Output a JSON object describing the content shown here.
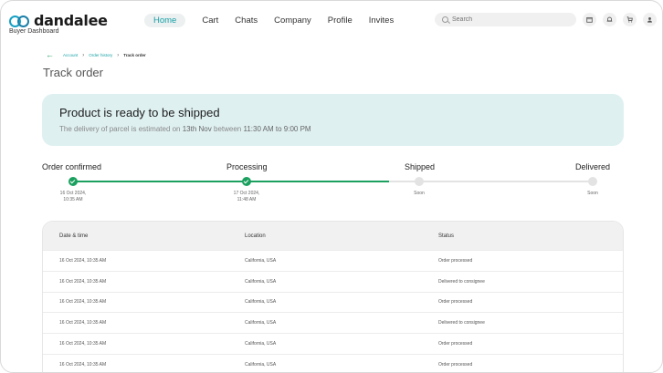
{
  "brand": {
    "name": "dandalee",
    "subtitle": "Buyer Dashboard"
  },
  "nav": [
    {
      "label": "Home",
      "active": true
    },
    {
      "label": "Cart"
    },
    {
      "label": "Chats"
    },
    {
      "label": "Company"
    },
    {
      "label": "Profile"
    },
    {
      "label": "Invites"
    }
  ],
  "search": {
    "placeholder": "Search"
  },
  "header_icons": [
    "calendar-icon",
    "bell-icon",
    "cart-icon",
    "user-icon"
  ],
  "breadcrumb": {
    "items": [
      "Account",
      "Order history",
      "Track order"
    ]
  },
  "page_title": "Track order",
  "banner": {
    "title": "Product is ready to be shipped",
    "text_prefix": "The delivery of parcel is estimated on ",
    "date": "13th Nov",
    "text_mid": " between ",
    "time_range": "11:30 AM to 9:00 PM"
  },
  "progress": {
    "steps": [
      {
        "label": "Order confirmed",
        "date_line1": "16 Oct 2024,",
        "date_line2": "10:35 AM",
        "done": true
      },
      {
        "label": "Processing",
        "date_line1": "17 Oct 2024,",
        "date_line2": "11:48 AM",
        "done": true
      },
      {
        "label": "Shipped",
        "date_line1": "Soon",
        "date_line2": "",
        "done": false
      },
      {
        "label": "Delivered",
        "date_line1": "Soon",
        "date_line2": "",
        "done": false
      }
    ],
    "accent_color": "#1ba05f"
  },
  "table": {
    "headers": [
      "Date & time",
      "Location",
      "Status"
    ],
    "rows": [
      [
        "16 Oct 2024, 10:35 AM",
        "California, USA",
        "Order processed"
      ],
      [
        "16 Oct 2024, 10:35 AM",
        "California, USA",
        "Delivered to consignee"
      ],
      [
        "16 Oct 2024, 10:35 AM",
        "California, USA",
        "Order processed"
      ],
      [
        "16 Oct 2024, 10:35 AM",
        "California, USA",
        "Delivered to consignee"
      ],
      [
        "16 Oct 2024, 10:35 AM",
        "California, USA",
        "Order processed"
      ],
      [
        "16 Oct 2024, 10:35 AM",
        "California, USA",
        "Order processed"
      ]
    ]
  }
}
